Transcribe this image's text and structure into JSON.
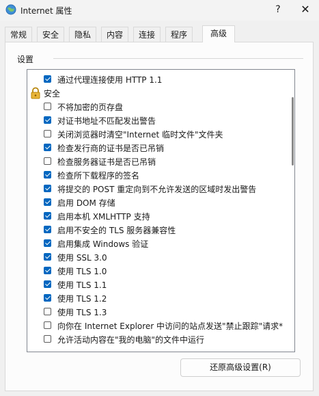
{
  "window": {
    "title": "Internet 属性",
    "help_label": "?",
    "close_label": "✕",
    "app_icon": "internet-globe-icon"
  },
  "tabs": [
    {
      "label": "常规",
      "active": false
    },
    {
      "label": "安全",
      "active": false
    },
    {
      "label": "隐私",
      "active": false
    },
    {
      "label": "内容",
      "active": false
    },
    {
      "label": "连接",
      "active": false
    },
    {
      "label": "程序",
      "active": false
    },
    {
      "label": "高级",
      "active": true
    }
  ],
  "settings": {
    "group_label": "设置",
    "items": [
      {
        "kind": "option",
        "label": "通过代理连接使用 HTTP 1.1",
        "checked": true
      },
      {
        "kind": "category",
        "label": "安全",
        "icon": "lock-icon"
      },
      {
        "kind": "option",
        "label": "不将加密的页存盘",
        "checked": false
      },
      {
        "kind": "option",
        "label": "对证书地址不匹配发出警告",
        "checked": true
      },
      {
        "kind": "option",
        "label": "关闭浏览器时清空\"Internet 临时文件\"文件夹",
        "checked": false
      },
      {
        "kind": "option",
        "label": "检查发行商的证书是否已吊销",
        "checked": true
      },
      {
        "kind": "option",
        "label": "检查服务器证书是否已吊销",
        "checked": false
      },
      {
        "kind": "option",
        "label": "检查所下载程序的签名",
        "checked": true
      },
      {
        "kind": "option",
        "label": "将提交的 POST 重定向到不允许发送的区域时发出警告",
        "checked": true
      },
      {
        "kind": "option",
        "label": "启用 DOM 存储",
        "checked": true
      },
      {
        "kind": "option",
        "label": "启用本机 XMLHTTP 支持",
        "checked": true
      },
      {
        "kind": "option",
        "label": "启用不安全的 TLS 服务器兼容性",
        "checked": true
      },
      {
        "kind": "option",
        "label": "启用集成 Windows 验证",
        "checked": true
      },
      {
        "kind": "option",
        "label": "使用 SSL 3.0",
        "checked": true
      },
      {
        "kind": "option",
        "label": "使用 TLS 1.0",
        "checked": true
      },
      {
        "kind": "option",
        "label": "使用 TLS 1.1",
        "checked": true
      },
      {
        "kind": "option",
        "label": "使用 TLS 1.2",
        "checked": true
      },
      {
        "kind": "option",
        "label": "使用 TLS 1.3",
        "checked": false
      },
      {
        "kind": "option",
        "label": "向你在 Internet Explorer 中访问的站点发送\"禁止跟踪\"请求*",
        "checked": false
      },
      {
        "kind": "option",
        "label": "允许活动内容在\"我的电脑\"的文件中运行",
        "checked": false
      }
    ]
  },
  "reset_button": "还原高级设置(R)"
}
